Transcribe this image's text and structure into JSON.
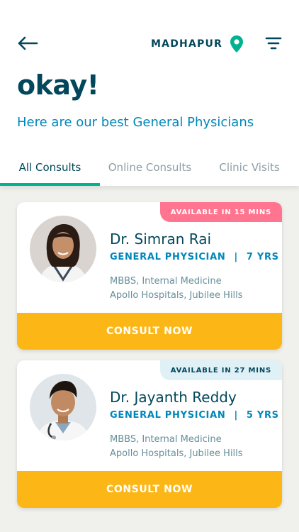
{
  "header": {
    "location": "MADHAPUR",
    "title": "okay!",
    "subtitle": "Here are our best General Physicians"
  },
  "icons": {
    "back": "back-arrow-icon",
    "location": "location-pin-icon",
    "filter": "filter-icon"
  },
  "colors": {
    "primary_text": "#02475b",
    "accent_blue": "#0087ba",
    "accent_green": "#00b38e",
    "consult_button": "#fcb716",
    "badge_pink": "#ff748e",
    "badge_blue": "#e0f0f7"
  },
  "tabs": [
    {
      "label": "All Consults",
      "active": true
    },
    {
      "label": "Online Consults",
      "active": false
    },
    {
      "label": "Clinic Visits",
      "active": false
    }
  ],
  "doctors": [
    {
      "availability": "AVAILABLE IN 15 MINS",
      "name": "Dr. Simran Rai",
      "specialty": "GENERAL PHYSICIAN",
      "separator": "|",
      "experience": "7 YRS",
      "qualification": "MBBS, Internal Medicine",
      "hospital": "Apollo Hospitals, Jubilee Hills",
      "button": "CONSULT NOW"
    },
    {
      "availability": "AVAILABLE IN 27 MINS",
      "name": "Dr. Jayanth Reddy",
      "specialty": "GENERAL PHYSICIAN",
      "separator": "|",
      "experience": "5 YRS",
      "qualification": "MBBS, Internal Medicine",
      "hospital": "Apollo Hospitals, Jubilee Hills",
      "button": "CONSULT NOW"
    }
  ]
}
